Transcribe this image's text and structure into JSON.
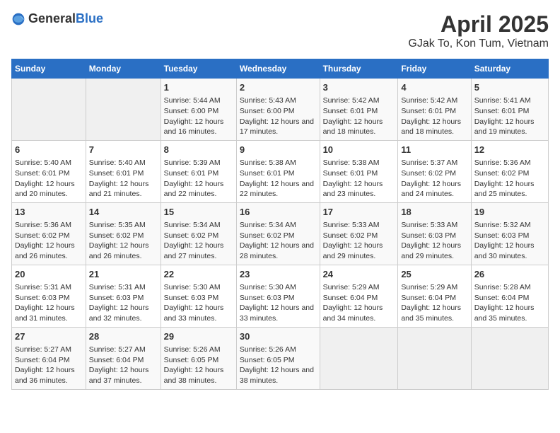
{
  "logo": {
    "general": "General",
    "blue": "Blue"
  },
  "title": "April 2025",
  "subtitle": "GJak To, Kon Tum, Vietnam",
  "days_of_week": [
    "Sunday",
    "Monday",
    "Tuesday",
    "Wednesday",
    "Thursday",
    "Friday",
    "Saturday"
  ],
  "weeks": [
    [
      {
        "day": "",
        "sunrise": "",
        "sunset": "",
        "daylight": ""
      },
      {
        "day": "",
        "sunrise": "",
        "sunset": "",
        "daylight": ""
      },
      {
        "day": "1",
        "sunrise": "Sunrise: 5:44 AM",
        "sunset": "Sunset: 6:00 PM",
        "daylight": "Daylight: 12 hours and 16 minutes."
      },
      {
        "day": "2",
        "sunrise": "Sunrise: 5:43 AM",
        "sunset": "Sunset: 6:00 PM",
        "daylight": "Daylight: 12 hours and 17 minutes."
      },
      {
        "day": "3",
        "sunrise": "Sunrise: 5:42 AM",
        "sunset": "Sunset: 6:01 PM",
        "daylight": "Daylight: 12 hours and 18 minutes."
      },
      {
        "day": "4",
        "sunrise": "Sunrise: 5:42 AM",
        "sunset": "Sunset: 6:01 PM",
        "daylight": "Daylight: 12 hours and 18 minutes."
      },
      {
        "day": "5",
        "sunrise": "Sunrise: 5:41 AM",
        "sunset": "Sunset: 6:01 PM",
        "daylight": "Daylight: 12 hours and 19 minutes."
      }
    ],
    [
      {
        "day": "6",
        "sunrise": "Sunrise: 5:40 AM",
        "sunset": "Sunset: 6:01 PM",
        "daylight": "Daylight: 12 hours and 20 minutes."
      },
      {
        "day": "7",
        "sunrise": "Sunrise: 5:40 AM",
        "sunset": "Sunset: 6:01 PM",
        "daylight": "Daylight: 12 hours and 21 minutes."
      },
      {
        "day": "8",
        "sunrise": "Sunrise: 5:39 AM",
        "sunset": "Sunset: 6:01 PM",
        "daylight": "Daylight: 12 hours and 22 minutes."
      },
      {
        "day": "9",
        "sunrise": "Sunrise: 5:38 AM",
        "sunset": "Sunset: 6:01 PM",
        "daylight": "Daylight: 12 hours and 22 minutes."
      },
      {
        "day": "10",
        "sunrise": "Sunrise: 5:38 AM",
        "sunset": "Sunset: 6:01 PM",
        "daylight": "Daylight: 12 hours and 23 minutes."
      },
      {
        "day": "11",
        "sunrise": "Sunrise: 5:37 AM",
        "sunset": "Sunset: 6:02 PM",
        "daylight": "Daylight: 12 hours and 24 minutes."
      },
      {
        "day": "12",
        "sunrise": "Sunrise: 5:36 AM",
        "sunset": "Sunset: 6:02 PM",
        "daylight": "Daylight: 12 hours and 25 minutes."
      }
    ],
    [
      {
        "day": "13",
        "sunrise": "Sunrise: 5:36 AM",
        "sunset": "Sunset: 6:02 PM",
        "daylight": "Daylight: 12 hours and 26 minutes."
      },
      {
        "day": "14",
        "sunrise": "Sunrise: 5:35 AM",
        "sunset": "Sunset: 6:02 PM",
        "daylight": "Daylight: 12 hours and 26 minutes."
      },
      {
        "day": "15",
        "sunrise": "Sunrise: 5:34 AM",
        "sunset": "Sunset: 6:02 PM",
        "daylight": "Daylight: 12 hours and 27 minutes."
      },
      {
        "day": "16",
        "sunrise": "Sunrise: 5:34 AM",
        "sunset": "Sunset: 6:02 PM",
        "daylight": "Daylight: 12 hours and 28 minutes."
      },
      {
        "day": "17",
        "sunrise": "Sunrise: 5:33 AM",
        "sunset": "Sunset: 6:02 PM",
        "daylight": "Daylight: 12 hours and 29 minutes."
      },
      {
        "day": "18",
        "sunrise": "Sunrise: 5:33 AM",
        "sunset": "Sunset: 6:03 PM",
        "daylight": "Daylight: 12 hours and 29 minutes."
      },
      {
        "day": "19",
        "sunrise": "Sunrise: 5:32 AM",
        "sunset": "Sunset: 6:03 PM",
        "daylight": "Daylight: 12 hours and 30 minutes."
      }
    ],
    [
      {
        "day": "20",
        "sunrise": "Sunrise: 5:31 AM",
        "sunset": "Sunset: 6:03 PM",
        "daylight": "Daylight: 12 hours and 31 minutes."
      },
      {
        "day": "21",
        "sunrise": "Sunrise: 5:31 AM",
        "sunset": "Sunset: 6:03 PM",
        "daylight": "Daylight: 12 hours and 32 minutes."
      },
      {
        "day": "22",
        "sunrise": "Sunrise: 5:30 AM",
        "sunset": "Sunset: 6:03 PM",
        "daylight": "Daylight: 12 hours and 33 minutes."
      },
      {
        "day": "23",
        "sunrise": "Sunrise: 5:30 AM",
        "sunset": "Sunset: 6:03 PM",
        "daylight": "Daylight: 12 hours and 33 minutes."
      },
      {
        "day": "24",
        "sunrise": "Sunrise: 5:29 AM",
        "sunset": "Sunset: 6:04 PM",
        "daylight": "Daylight: 12 hours and 34 minutes."
      },
      {
        "day": "25",
        "sunrise": "Sunrise: 5:29 AM",
        "sunset": "Sunset: 6:04 PM",
        "daylight": "Daylight: 12 hours and 35 minutes."
      },
      {
        "day": "26",
        "sunrise": "Sunrise: 5:28 AM",
        "sunset": "Sunset: 6:04 PM",
        "daylight": "Daylight: 12 hours and 35 minutes."
      }
    ],
    [
      {
        "day": "27",
        "sunrise": "Sunrise: 5:27 AM",
        "sunset": "Sunset: 6:04 PM",
        "daylight": "Daylight: 12 hours and 36 minutes."
      },
      {
        "day": "28",
        "sunrise": "Sunrise: 5:27 AM",
        "sunset": "Sunset: 6:04 PM",
        "daylight": "Daylight: 12 hours and 37 minutes."
      },
      {
        "day": "29",
        "sunrise": "Sunrise: 5:26 AM",
        "sunset": "Sunset: 6:05 PM",
        "daylight": "Daylight: 12 hours and 38 minutes."
      },
      {
        "day": "30",
        "sunrise": "Sunrise: 5:26 AM",
        "sunset": "Sunset: 6:05 PM",
        "daylight": "Daylight: 12 hours and 38 minutes."
      },
      {
        "day": "",
        "sunrise": "",
        "sunset": "",
        "daylight": ""
      },
      {
        "day": "",
        "sunrise": "",
        "sunset": "",
        "daylight": ""
      },
      {
        "day": "",
        "sunrise": "",
        "sunset": "",
        "daylight": ""
      }
    ]
  ]
}
